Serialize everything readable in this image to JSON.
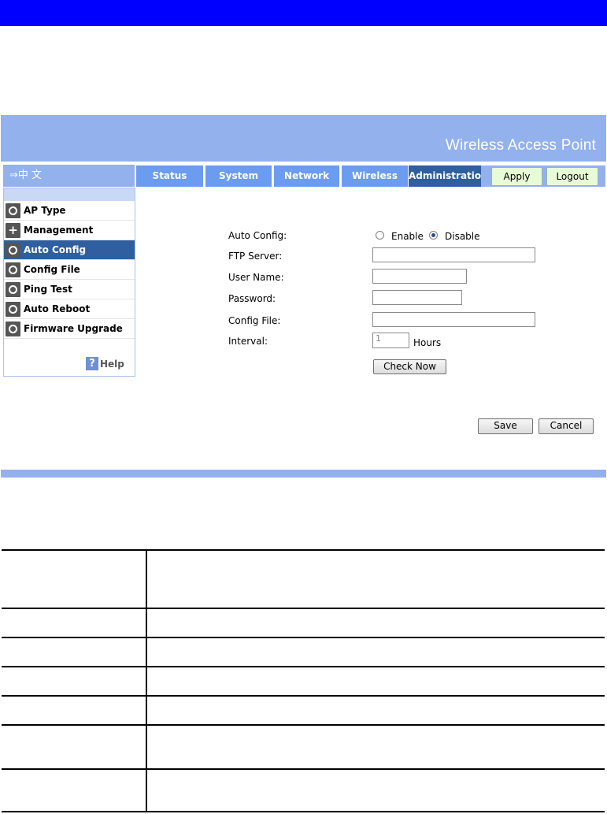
{
  "banner": {
    "title": "Wireless Access Point"
  },
  "language": {
    "label": "⇒中 文"
  },
  "tabs": [
    {
      "label": "Status"
    },
    {
      "label": "System"
    },
    {
      "label": "Network"
    },
    {
      "label": "Wireless"
    },
    {
      "label": "Administration",
      "active": true
    }
  ],
  "header_buttons": {
    "apply": "Apply",
    "logout": "Logout"
  },
  "sidebar": {
    "items": [
      {
        "label": "AP Type",
        "icon": "circle-icon"
      },
      {
        "label": "Management",
        "icon": "plus-icon"
      },
      {
        "label": "Auto Config",
        "icon": "circle-icon",
        "active": true
      },
      {
        "label": "Config File",
        "icon": "circle-icon"
      },
      {
        "label": "Ping Test",
        "icon": "circle-icon"
      },
      {
        "label": "Auto Reboot",
        "icon": "circle-icon"
      },
      {
        "label": "Firmware Upgrade",
        "icon": "circle-icon"
      }
    ],
    "help": {
      "icon_glyph": "?",
      "label": "Help"
    }
  },
  "form": {
    "auto_config": {
      "label": "Auto Config:",
      "options": [
        "Enable",
        "Disable"
      ],
      "selected": "Disable"
    },
    "ftp_server": {
      "label": "FTP Server:",
      "value": ""
    },
    "user_name": {
      "label": "User Name:",
      "value": ""
    },
    "password": {
      "label": "Password:",
      "value": ""
    },
    "config_file": {
      "label": "Config File:",
      "value": ""
    },
    "interval": {
      "label": "Interval:",
      "value": "1",
      "unit": "Hours"
    },
    "check_now": "Check Now",
    "save": "Save",
    "cancel": "Cancel"
  },
  "colors": {
    "doc_bar": "#0000ff",
    "banner": "#93b1ed",
    "tab": "#6b9cf0",
    "tab_active": "#2f5f9e",
    "button_green": "#e8fbd7"
  }
}
